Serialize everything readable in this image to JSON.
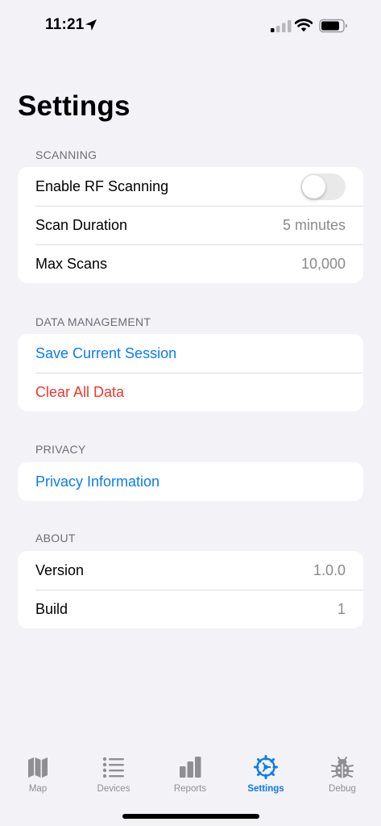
{
  "status_bar": {
    "time": "11:21"
  },
  "page_title": "Settings",
  "sections": {
    "scanning": {
      "header": "SCANNING",
      "enable_rf_label": "Enable RF Scanning",
      "enable_rf_on": false,
      "scan_duration_label": "Scan Duration",
      "scan_duration_value": "5 minutes",
      "max_scans_label": "Max Scans",
      "max_scans_value": "10,000"
    },
    "data_management": {
      "header": "DATA MANAGEMENT",
      "save_session": "Save Current Session",
      "clear_all": "Clear All Data"
    },
    "privacy": {
      "header": "PRIVACY",
      "privacy_info": "Privacy Information"
    },
    "about": {
      "header": "ABOUT",
      "version_label": "Version",
      "version_value": "1.0.0",
      "build_label": "Build",
      "build_value": "1"
    }
  },
  "tab_bar": {
    "active": "Settings",
    "tabs": [
      {
        "label": "Map",
        "icon": "map-icon"
      },
      {
        "label": "Devices",
        "icon": "list-icon"
      },
      {
        "label": "Reports",
        "icon": "bar-chart-icon"
      },
      {
        "label": "Settings",
        "icon": "gear-icon"
      },
      {
        "label": "Debug",
        "icon": "bug-icon"
      }
    ]
  },
  "colors": {
    "accent": "#0a7cf0",
    "destructive": "#f0362c",
    "background": "#f2f2f7",
    "secondary_text": "#8a8a8e"
  }
}
